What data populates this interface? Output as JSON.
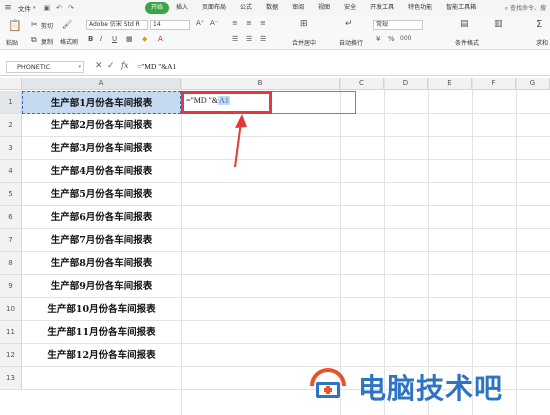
{
  "menu": {
    "file_label": "文件",
    "tabs": [
      "开始",
      "插入",
      "页面布局",
      "公式",
      "数据",
      "审阅",
      "视图",
      "安全",
      "开发工具",
      "特色功能",
      "智能工具箱"
    ],
    "active_tab": "开始",
    "search_label": "查找命令、搜"
  },
  "ribbon": {
    "paste_label": "粘贴",
    "cut_label": "剪切",
    "copy_label": "复制",
    "format_painter_label": "格式刷",
    "font_name": "Adobe 仿宋 Std R",
    "font_size": "14",
    "merge_label": "合并居中",
    "wrap_label": "自动换行",
    "number_format": "常规",
    "conditional_format_label": "条件格式",
    "sum_label": "求和"
  },
  "formula_bar": {
    "name_box": "PHONETIC",
    "content": "=\"MD \"&A1"
  },
  "grid": {
    "columns": [
      "A",
      "B",
      "C",
      "D",
      "E",
      "F",
      "G"
    ],
    "rows": [
      "1",
      "2",
      "3",
      "4",
      "5",
      "6",
      "7",
      "8",
      "9",
      "10",
      "11",
      "12",
      "13"
    ],
    "col_a": [
      "生产部1月份各车间报表",
      "生产部2月份各车间报表",
      "生产部3月份各车间报表",
      "生产部4月份各车间报表",
      "生产部5月份各车间报表",
      "生产部6月份各车间报表",
      "生产部7月份各车间报表",
      "生产部8月份各车间报表",
      "生产部9月份各车间报表",
      "生产部10月份各车间报表",
      "生产部11月份各车间报表",
      "生产部12月份各车间报表",
      ""
    ],
    "editing_cell": {
      "prefix": "=\"MD \"&",
      "ref": "A1"
    }
  },
  "watermark": {
    "text": "电脑技术吧"
  },
  "colors": {
    "accent": "#3aa546",
    "highlight_red": "#e23a3a",
    "selection_blue": "#c5d9f1",
    "watermark_blue": "#2f74c4"
  }
}
